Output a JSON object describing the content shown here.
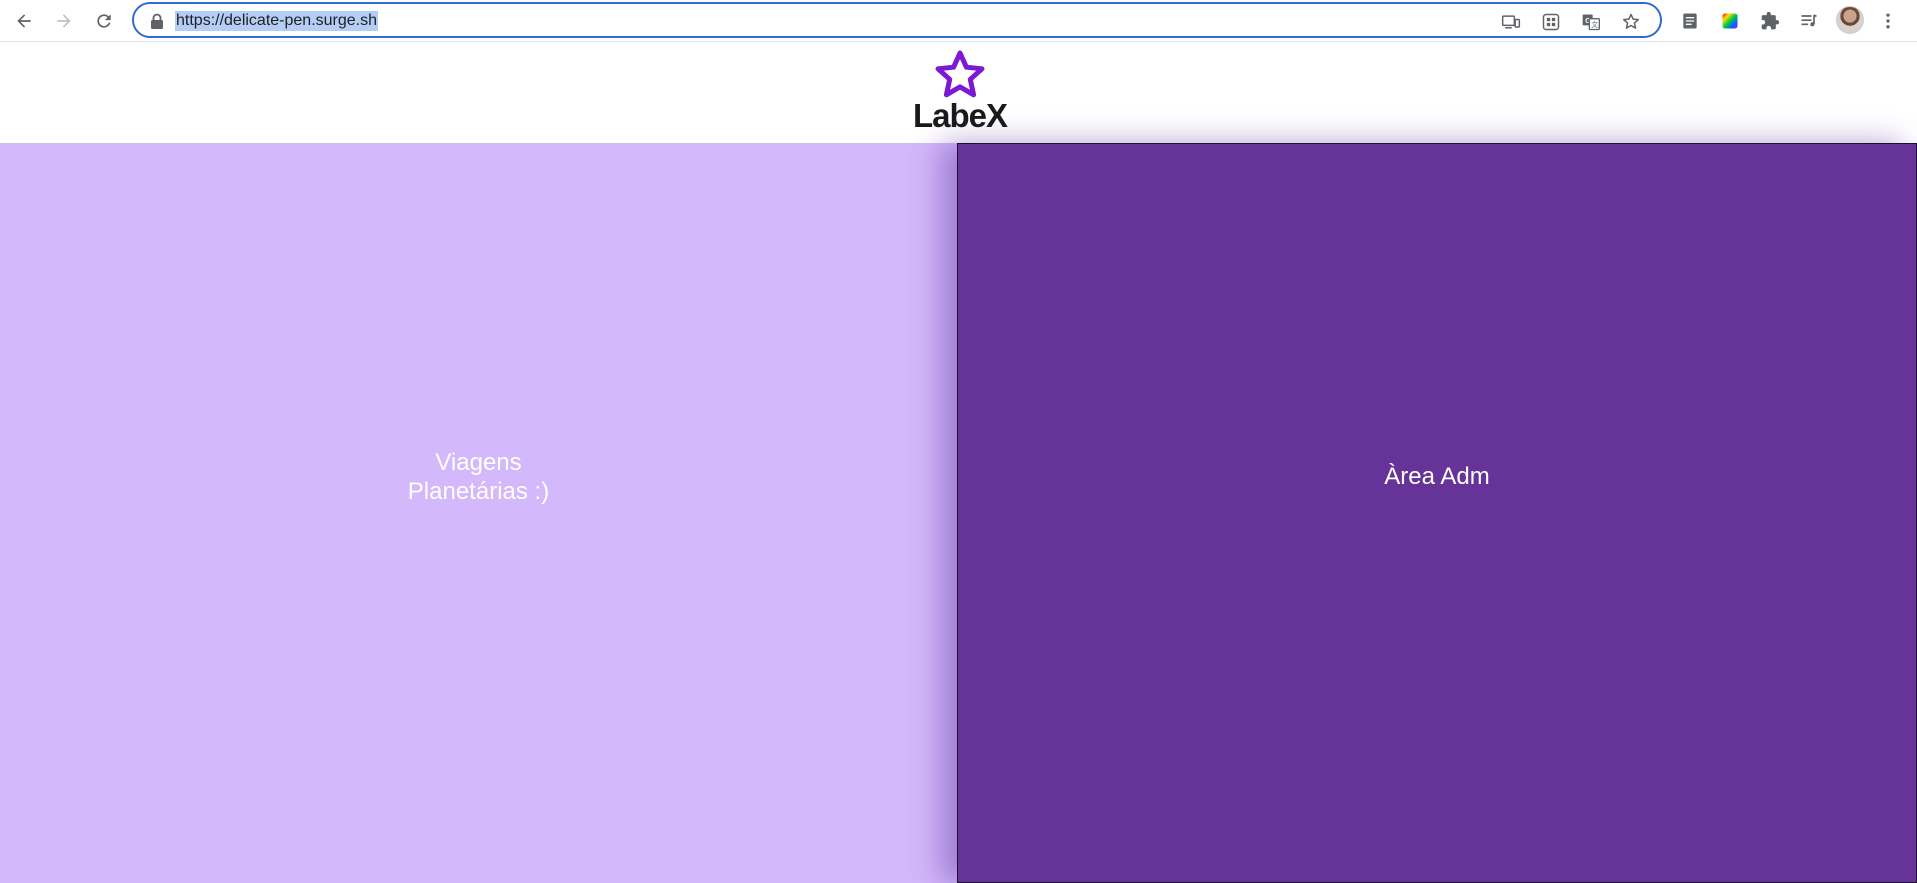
{
  "browser": {
    "url": "https://delicate-pen.surge.sh",
    "icons": {
      "back": "arrow-left-icon",
      "forward": "arrow-right-icon",
      "reload": "reload-icon",
      "lock": "lock-icon",
      "cast": "cast-icon",
      "app": "app-grid-icon",
      "translate": "translate-icon",
      "bookmark": "star-icon",
      "extensions": "puzzle-icon",
      "menu": "kebab-menu-icon"
    }
  },
  "header": {
    "brand": "LabeX",
    "logo_color": "#7b19d3"
  },
  "main": {
    "left_panel": {
      "label": "Viagens Planetárias :)",
      "color": "#d4b8fc"
    },
    "right_panel": {
      "label": "Àrea Adm",
      "color": "#663399"
    }
  }
}
